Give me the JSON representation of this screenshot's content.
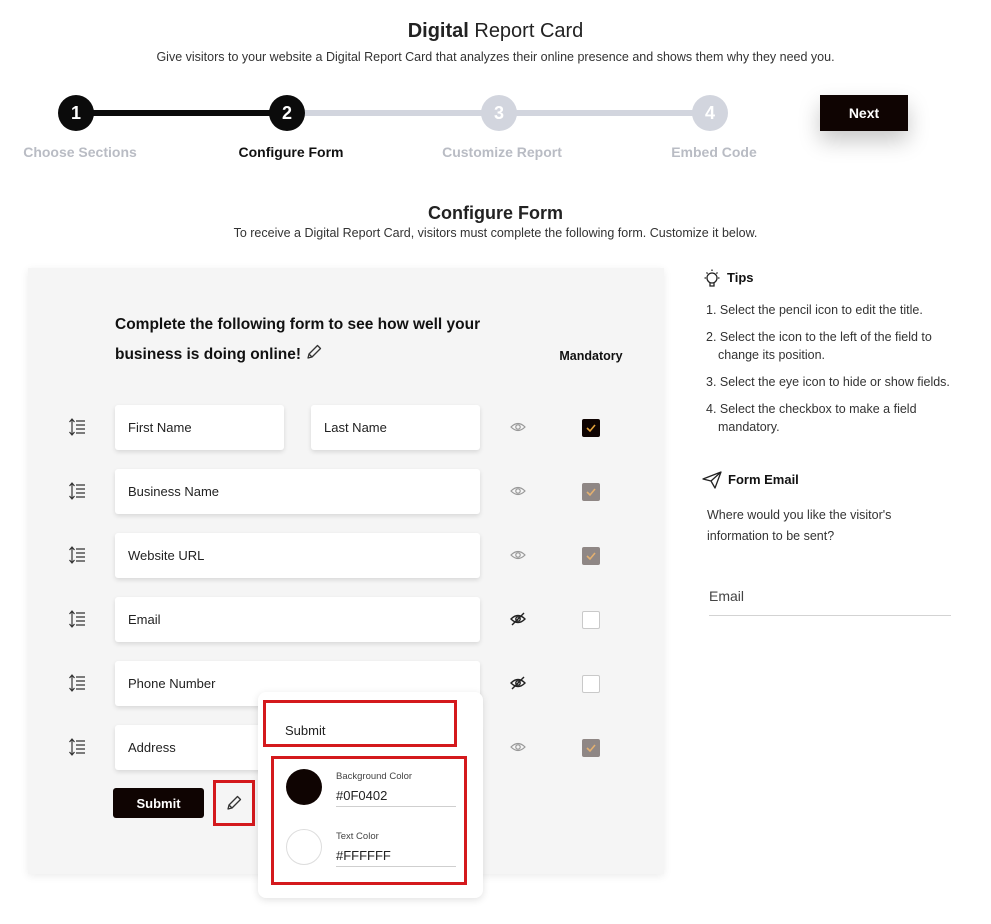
{
  "header": {
    "title_bold": "Digital",
    "title_rest": " Report Card",
    "subtitle": "Give visitors to your website a Digital Report Card that analyzes their online presence and shows them why they need you."
  },
  "stepper": {
    "steps": [
      {
        "number": "1",
        "label": "Choose Sections",
        "state": "done"
      },
      {
        "number": "2",
        "label": "Configure Form",
        "state": "active"
      },
      {
        "number": "3",
        "label": "Customize Report",
        "state": "todo"
      },
      {
        "number": "4",
        "label": "Embed Code",
        "state": "todo"
      }
    ],
    "next_label": "Next"
  },
  "section": {
    "title": "Configure Form",
    "description": "To receive a Digital Report Card, visitors must complete the following form. Customize it below."
  },
  "form": {
    "heading_line1": "Complete the following form to see how well your",
    "heading_line2": "business is doing online!",
    "mandatory_label": "Mandatory",
    "fields": [
      {
        "label": "First Name",
        "visible": true,
        "mandatory": true
      },
      {
        "label": "Last Name",
        "visible": true,
        "mandatory": true
      },
      {
        "label": "Business Name",
        "visible": true,
        "mandatory": true
      },
      {
        "label": "Website URL",
        "visible": true,
        "mandatory": true
      },
      {
        "label": "Email",
        "visible": false,
        "mandatory": false
      },
      {
        "label": "Phone Number",
        "visible": false,
        "mandatory": false
      },
      {
        "label": "Address",
        "visible": true,
        "mandatory": true
      }
    ],
    "submit_label": "Submit"
  },
  "submit_editor": {
    "text_value": "Submit",
    "background_color_label": "Background Color",
    "background_color_value": "#0F0402",
    "text_color_label": "Text Color",
    "text_color_value": "#FFFFFF"
  },
  "tips": {
    "title": "Tips",
    "items": [
      "1. Select the pencil icon to edit the title.",
      "2. Select the icon to the left of the field to change its position.",
      "3. Select the eye icon to hide or show fields.",
      "4. Select the checkbox to make a field mandatory."
    ]
  },
  "form_email": {
    "title": "Form Email",
    "description": "Where would you like the visitor's information to be sent?",
    "placeholder": "Email"
  },
  "colors": {
    "accent": "#0F0402",
    "highlight": "#D4191D",
    "step_inactive": "#D2D5DE",
    "check_gray": "#8F8785"
  }
}
